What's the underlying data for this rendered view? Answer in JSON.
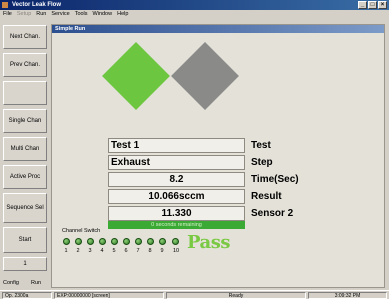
{
  "window": {
    "title": "Vector Leak Flow"
  },
  "menu": [
    "File",
    "Setup",
    "Run",
    "Service",
    "Tools",
    "Window",
    "Help"
  ],
  "sidebar": {
    "buttons": [
      "Next Chan.",
      "Prev Chan.",
      "",
      "Single Chan",
      "Multi Chan",
      "Active Proc",
      "Sequence Sel",
      "Start",
      "1"
    ],
    "bottom": [
      "Config",
      "Run"
    ]
  },
  "panel": {
    "title": "Simple Run",
    "indicator_colors": {
      "left": "#6cc63f",
      "right": "#8a8a88"
    },
    "fields": [
      {
        "value": "Test 1",
        "label": "Test"
      },
      {
        "value": "Exhaust",
        "label": "Step"
      },
      {
        "value": "8.2",
        "label": "Time(Sec)"
      },
      {
        "value": "10.066sccm",
        "label": "Result"
      },
      {
        "value": "11.330",
        "label": "Sensor 2"
      }
    ],
    "progress_text": "0 seconds remaining",
    "channel_switch_label": "Channel Switch",
    "channels": [
      "1",
      "2",
      "3",
      "4",
      "5",
      "6",
      "7",
      "8",
      "9",
      "10"
    ],
    "result": "Pass",
    "result_color": "#7ac943"
  },
  "status": {
    "cells": [
      "Op. 2300a",
      "EXP:00000000  [screen]",
      "Ready",
      "3:09:32 PM"
    ]
  }
}
